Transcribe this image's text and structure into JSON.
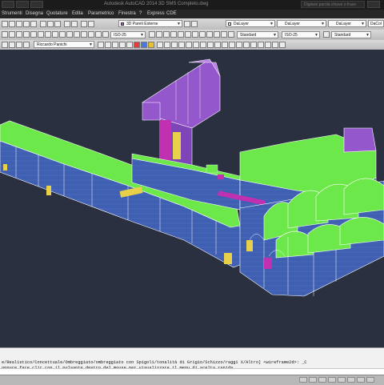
{
  "titlebar": {
    "title": "Autodesk AutoCAD 2014   3D SMS Completo.dwg",
    "search_placeholder": "Digitare parola chiave o frase"
  },
  "menubar": {
    "items": [
      "Strumenti",
      "Disegna",
      "Quotature",
      "Edita",
      "Parametrico",
      "Finestra",
      "?",
      "Express",
      "CDE"
    ]
  },
  "toolbar": {
    "layer_state": "3D Pareti Esterne",
    "color_value": "DaLayer",
    "linetype_value": "DaLayer",
    "lineweight_value": "DaLayer",
    "plotstyle_value": "DaCol",
    "textstyle_value": "Standard",
    "dimstyle_value": "ISO-25",
    "tablestyle_value": "Standard",
    "multileader_value": "Standard",
    "dimstyle2_value": "ISO-25",
    "user_value": "Riccardo Panichi",
    "layer_swatch_color": "#a060e0"
  },
  "command": {
    "line1": "e/Realistico/Concettuale/Ombreggiato/ombreggiato con Spigoli/tonalità di Grigio/Schizzo/raggi X/Altro] <wireframe2d>: _C",
    "line2": "oppure fare clic con il pulsante destro del mouse per visualizzare il menu di scelta rapida."
  },
  "viewport": {
    "background": "#2b3040",
    "palette": {
      "roof": "#6de84a",
      "wall": "#3f5fb2",
      "wall_purple": "#9558cc",
      "magenta": "#c030b0",
      "yellow": "#e8d04a",
      "edge": "#ffffff"
    }
  }
}
